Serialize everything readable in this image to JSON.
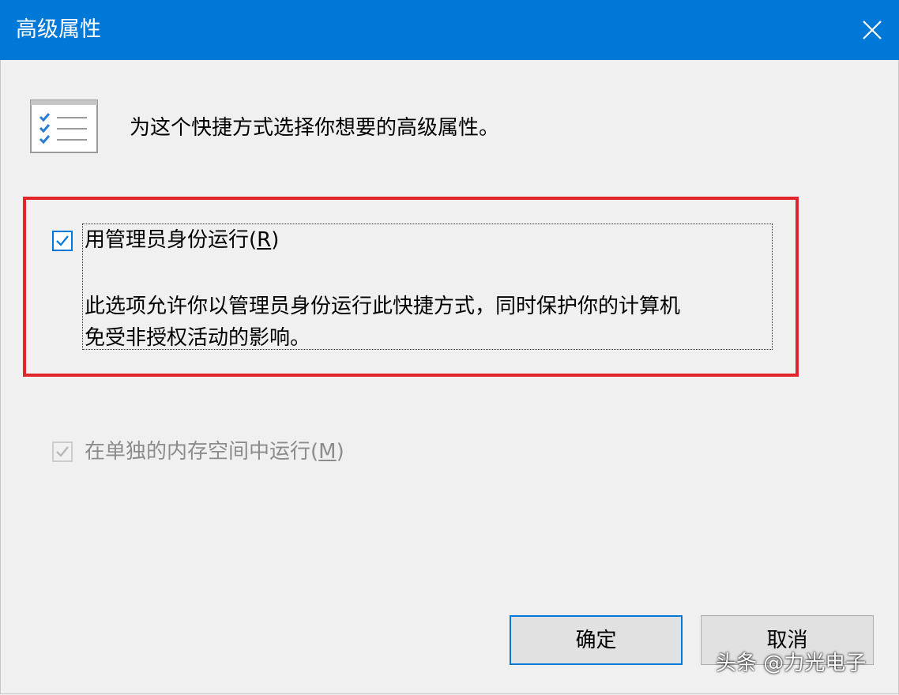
{
  "window": {
    "title": "高级属性",
    "close_icon": "close-icon"
  },
  "header": {
    "icon": "checklist-icon",
    "prompt": "为这个快捷方式选择你想要的高级属性。"
  },
  "options": {
    "run_as_admin": {
      "label": "用管理员身份运行",
      "mnemonic_open": "(",
      "mnemonic": "R",
      "mnemonic_close": ")",
      "checked": true,
      "description_line1": "此选项允许你以管理员身份运行此快捷方式，同时保护你的计算机",
      "description_line2": "免受非授权活动的影响。"
    },
    "separate_memory": {
      "label": "在单独的内存空间中运行",
      "mnemonic_open": "(",
      "mnemonic": "M",
      "mnemonic_close": ")",
      "checked": true,
      "enabled": false
    }
  },
  "buttons": {
    "ok_label": "确定",
    "cancel_label": "取消"
  },
  "watermark": "头条 @力光电子",
  "colors": {
    "titlebar": "#0078d7",
    "highlight": "#e0262a",
    "check_accent": "#0078d7",
    "disabled_text": "#8c8c8c"
  }
}
